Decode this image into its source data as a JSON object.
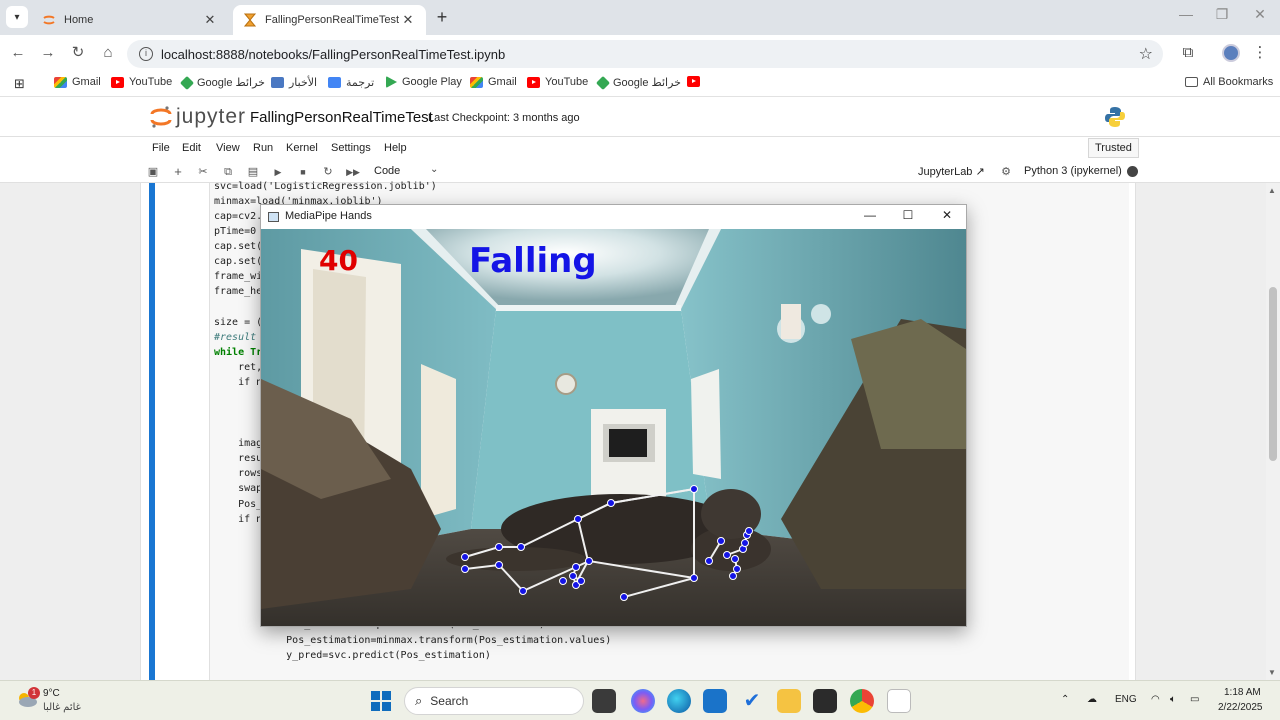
{
  "browser": {
    "tabs": [
      {
        "title": "Home",
        "active": false
      },
      {
        "title": "FallingPersonRealTimeTest",
        "active": true
      }
    ],
    "url": "localhost:8888/notebooks/FallingPersonRealTimeTest.ipynb",
    "bookmarks": [
      {
        "label": "Gmail",
        "icon": "gmail-icon"
      },
      {
        "label": "YouTube",
        "icon": "youtube-icon"
      },
      {
        "label": "Google خرائط",
        "icon": "maps-icon"
      },
      {
        "label": "الأخبار",
        "icon": "news-icon"
      },
      {
        "label": "ترجمة",
        "icon": "translate-icon"
      },
      {
        "label": "Google Play",
        "icon": "play-icon"
      },
      {
        "label": "Gmail",
        "icon": "gmail-icon"
      },
      {
        "label": "YouTube",
        "icon": "youtube-icon"
      },
      {
        "label": "Google خرائط",
        "icon": "maps-icon"
      }
    ],
    "all_bookmarks": "All Bookmarks"
  },
  "jupyter": {
    "logo": "jupyter",
    "notebook_title": "FallingPersonRealTimeTest",
    "checkpoint": "Last Checkpoint: 3 months ago",
    "menu": [
      "File",
      "Edit",
      "View",
      "Run",
      "Kernel",
      "Settings",
      "Help"
    ],
    "trusted": "Trusted",
    "cell_type": "Code",
    "jupyterlab_link": "JupyterLab",
    "kernel": "Python 3 (ipykernel)"
  },
  "code_lines": {
    "l1": "svc=load('LogisticRegression.joblib')",
    "l2": "minmax=load('minmax.joblib')",
    "l3": "cap=cv2.",
    "l4": "pTime=0",
    "l5": "cap.set(",
    "l6": "cap.set(",
    "l7": "frame_wi",
    "l8": "frame_he",
    "l9": "size = (",
    "l10": "#result",
    "l11": "while Tr",
    "l12": "    ret,",
    "l13": "    if n",
    "l14": "    imag",
    "l15": "    resu",
    "l16": "    rows",
    "l17": "    swap",
    "l18": "    Pos_",
    "l19": "    if n",
    "l20": "        Pos_estimation=pd.DataFrame(Pos_estimation)",
    "l21": "        Pos_estimation=minmax.transform(Pos_estimation.values)",
    "l22": "        y_pred=svc.predict(Pos_estimation)"
  },
  "mediapipe_window": {
    "title": "MediaPipe Hands",
    "fps": "40",
    "status": "Falling",
    "fps_color": "#e00000",
    "status_color": "#1414e6"
  },
  "taskbar": {
    "weather_temp": "9°C",
    "weather_desc": "غائم غالبا",
    "weather_badge": "1",
    "search_label": "Search",
    "language": "ENG",
    "time": "1:18 AM",
    "date": "2/22/2025"
  },
  "colors": {
    "accent": "#1976d2",
    "keypoint": "#1414e6",
    "skeleton": "#f0f0f0"
  }
}
